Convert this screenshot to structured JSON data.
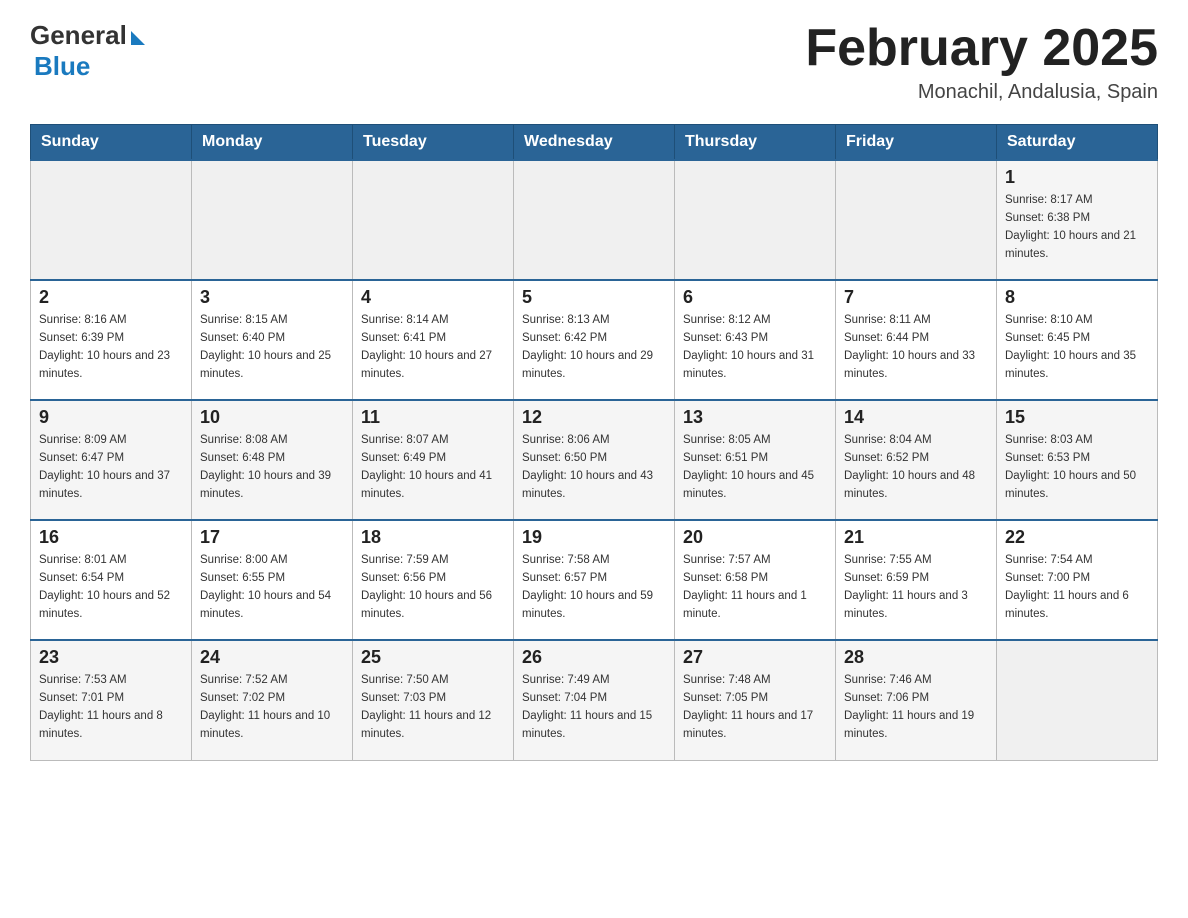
{
  "header": {
    "logo_general": "General",
    "logo_blue": "Blue",
    "title": "February 2025",
    "subtitle": "Monachil, Andalusia, Spain"
  },
  "days_of_week": [
    "Sunday",
    "Monday",
    "Tuesday",
    "Wednesday",
    "Thursday",
    "Friday",
    "Saturday"
  ],
  "weeks": [
    [
      {
        "day": "",
        "info": ""
      },
      {
        "day": "",
        "info": ""
      },
      {
        "day": "",
        "info": ""
      },
      {
        "day": "",
        "info": ""
      },
      {
        "day": "",
        "info": ""
      },
      {
        "day": "",
        "info": ""
      },
      {
        "day": "1",
        "info": "Sunrise: 8:17 AM\nSunset: 6:38 PM\nDaylight: 10 hours and 21 minutes."
      }
    ],
    [
      {
        "day": "2",
        "info": "Sunrise: 8:16 AM\nSunset: 6:39 PM\nDaylight: 10 hours and 23 minutes."
      },
      {
        "day": "3",
        "info": "Sunrise: 8:15 AM\nSunset: 6:40 PM\nDaylight: 10 hours and 25 minutes."
      },
      {
        "day": "4",
        "info": "Sunrise: 8:14 AM\nSunset: 6:41 PM\nDaylight: 10 hours and 27 minutes."
      },
      {
        "day": "5",
        "info": "Sunrise: 8:13 AM\nSunset: 6:42 PM\nDaylight: 10 hours and 29 minutes."
      },
      {
        "day": "6",
        "info": "Sunrise: 8:12 AM\nSunset: 6:43 PM\nDaylight: 10 hours and 31 minutes."
      },
      {
        "day": "7",
        "info": "Sunrise: 8:11 AM\nSunset: 6:44 PM\nDaylight: 10 hours and 33 minutes."
      },
      {
        "day": "8",
        "info": "Sunrise: 8:10 AM\nSunset: 6:45 PM\nDaylight: 10 hours and 35 minutes."
      }
    ],
    [
      {
        "day": "9",
        "info": "Sunrise: 8:09 AM\nSunset: 6:47 PM\nDaylight: 10 hours and 37 minutes."
      },
      {
        "day": "10",
        "info": "Sunrise: 8:08 AM\nSunset: 6:48 PM\nDaylight: 10 hours and 39 minutes."
      },
      {
        "day": "11",
        "info": "Sunrise: 8:07 AM\nSunset: 6:49 PM\nDaylight: 10 hours and 41 minutes."
      },
      {
        "day": "12",
        "info": "Sunrise: 8:06 AM\nSunset: 6:50 PM\nDaylight: 10 hours and 43 minutes."
      },
      {
        "day": "13",
        "info": "Sunrise: 8:05 AM\nSunset: 6:51 PM\nDaylight: 10 hours and 45 minutes."
      },
      {
        "day": "14",
        "info": "Sunrise: 8:04 AM\nSunset: 6:52 PM\nDaylight: 10 hours and 48 minutes."
      },
      {
        "day": "15",
        "info": "Sunrise: 8:03 AM\nSunset: 6:53 PM\nDaylight: 10 hours and 50 minutes."
      }
    ],
    [
      {
        "day": "16",
        "info": "Sunrise: 8:01 AM\nSunset: 6:54 PM\nDaylight: 10 hours and 52 minutes."
      },
      {
        "day": "17",
        "info": "Sunrise: 8:00 AM\nSunset: 6:55 PM\nDaylight: 10 hours and 54 minutes."
      },
      {
        "day": "18",
        "info": "Sunrise: 7:59 AM\nSunset: 6:56 PM\nDaylight: 10 hours and 56 minutes."
      },
      {
        "day": "19",
        "info": "Sunrise: 7:58 AM\nSunset: 6:57 PM\nDaylight: 10 hours and 59 minutes."
      },
      {
        "day": "20",
        "info": "Sunrise: 7:57 AM\nSunset: 6:58 PM\nDaylight: 11 hours and 1 minute."
      },
      {
        "day": "21",
        "info": "Sunrise: 7:55 AM\nSunset: 6:59 PM\nDaylight: 11 hours and 3 minutes."
      },
      {
        "day": "22",
        "info": "Sunrise: 7:54 AM\nSunset: 7:00 PM\nDaylight: 11 hours and 6 minutes."
      }
    ],
    [
      {
        "day": "23",
        "info": "Sunrise: 7:53 AM\nSunset: 7:01 PM\nDaylight: 11 hours and 8 minutes."
      },
      {
        "day": "24",
        "info": "Sunrise: 7:52 AM\nSunset: 7:02 PM\nDaylight: 11 hours and 10 minutes."
      },
      {
        "day": "25",
        "info": "Sunrise: 7:50 AM\nSunset: 7:03 PM\nDaylight: 11 hours and 12 minutes."
      },
      {
        "day": "26",
        "info": "Sunrise: 7:49 AM\nSunset: 7:04 PM\nDaylight: 11 hours and 15 minutes."
      },
      {
        "day": "27",
        "info": "Sunrise: 7:48 AM\nSunset: 7:05 PM\nDaylight: 11 hours and 17 minutes."
      },
      {
        "day": "28",
        "info": "Sunrise: 7:46 AM\nSunset: 7:06 PM\nDaylight: 11 hours and 19 minutes."
      },
      {
        "day": "",
        "info": ""
      }
    ]
  ]
}
